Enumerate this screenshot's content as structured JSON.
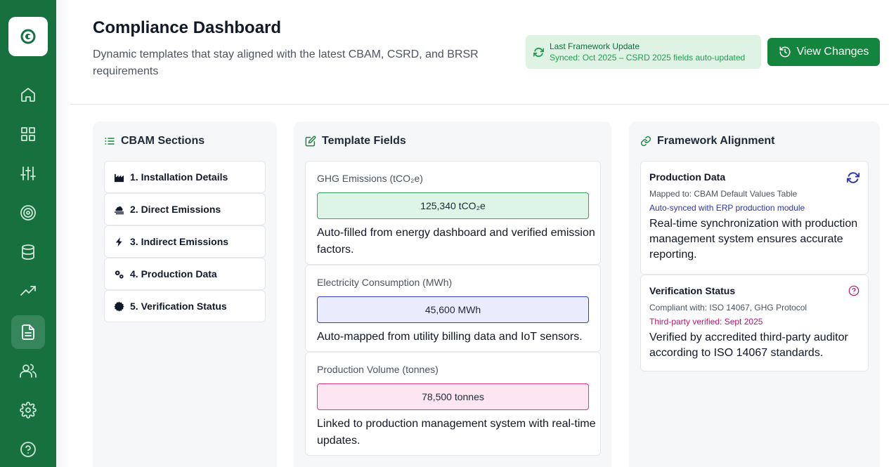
{
  "sidebar": {
    "logo_icon": "logo-icon",
    "items": [
      {
        "name": "home-icon",
        "active": false
      },
      {
        "name": "dashboard-grid-icon",
        "active": false
      },
      {
        "name": "sliders-icon",
        "active": false
      },
      {
        "name": "target-icon",
        "active": false
      },
      {
        "name": "database-icon",
        "active": false
      },
      {
        "name": "trending-up-icon",
        "active": false
      },
      {
        "name": "document-icon",
        "active": true
      },
      {
        "name": "users-icon",
        "active": false
      },
      {
        "name": "settings-icon",
        "active": false
      },
      {
        "name": "help-icon",
        "active": false
      }
    ],
    "colors": {
      "background": "#17713f"
    }
  },
  "header": {
    "title": "Compliance Dashboard",
    "subtitle": "Dynamic templates that stay aligned with the latest CBAM, CSRD, and BRSR requirements",
    "sync": {
      "title": "Last Framework Update",
      "detail": "Synced: Oct 2025 – CSRD 2025 fields auto-updated",
      "icon": "refresh-icon"
    },
    "view_changes_label": "View Changes"
  },
  "cbam": {
    "title": "CBAM Sections",
    "items": [
      {
        "label": "1. Installation Details",
        "icon": "factory-icon"
      },
      {
        "label": "2. Direct Emissions",
        "icon": "smog-icon"
      },
      {
        "label": "3. Indirect Emissions",
        "icon": "bolt-icon"
      },
      {
        "label": "4. Production Data",
        "icon": "gears-icon"
      },
      {
        "label": "5. Verification Status",
        "icon": "certificate-icon"
      }
    ]
  },
  "template": {
    "title": "Template Fields",
    "fields": [
      {
        "label": "GHG Emissions (tCO₂e)",
        "value": "125,340 tCO₂e",
        "description": "Auto-filled from energy dashboard and verified emission factors.",
        "color": "#37a45d"
      },
      {
        "label": "Electricity Consumption (MWh)",
        "value": "45,600 MWh",
        "description": "Auto-mapped from utility billing data and IoT sensors.",
        "color": "#3941b8"
      },
      {
        "label": "Production Volume (tonnes)",
        "value": "78,500 tonnes",
        "description": "Linked to production management system with real-time updates.",
        "color": "#d23b80"
      }
    ]
  },
  "alignment": {
    "title": "Framework Alignment",
    "cards": [
      {
        "title": "Production Data",
        "mapped": "Mapped to: CBAM Default Values Table",
        "status": "Auto-synced with ERP production module",
        "status_color": "#2f35b0",
        "description": "Real-time synchronization with production management system ensures accurate reporting.",
        "icon": "sync-icon"
      },
      {
        "title": "Verification Status",
        "mapped": "Compliant with: ISO 14067, GHG Protocol",
        "status": "Third-party verified: Sept 2025",
        "status_color": "#b5176e",
        "description": "Verified by accredited third-party auditor according to ISO 14067 standards.",
        "icon": "question-circle-icon"
      }
    ]
  }
}
